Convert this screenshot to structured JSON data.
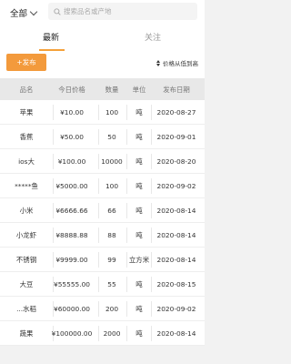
{
  "header": {
    "region_label": "全部",
    "search_placeholder": "搜索品名或产地"
  },
  "tabs": [
    {
      "label": "最新",
      "active": true
    },
    {
      "label": "关注",
      "active": false
    }
  ],
  "actions": {
    "publish_label": "+发布",
    "sort_label": "价格从低到高"
  },
  "colors": {
    "accent": "#f39a3c",
    "header_bg": "#e8e8e8"
  },
  "table": {
    "columns": [
      "品名",
      "今日价格",
      "数量",
      "单位",
      "发布日期"
    ],
    "rows": [
      {
        "name": "苹果",
        "price": "¥10.00",
        "qty": "100",
        "unit": "吨",
        "date": "2020-08-27"
      },
      {
        "name": "香蕉",
        "price": "¥50.00",
        "qty": "50",
        "unit": "吨",
        "date": "2020-09-01"
      },
      {
        "name": "ios大",
        "price": "¥100.00",
        "qty": "10000",
        "unit": "吨",
        "date": "2020-08-20"
      },
      {
        "name": "*****鱼",
        "price": "¥5000.00",
        "qty": "100",
        "unit": "吨",
        "date": "2020-09-02"
      },
      {
        "name": "小米",
        "price": "¥6666.66",
        "qty": "66",
        "unit": "吨",
        "date": "2020-08-14"
      },
      {
        "name": "小龙虾",
        "price": "¥8888.88",
        "qty": "88",
        "unit": "吨",
        "date": "2020-08-14"
      },
      {
        "name": "不锈钢",
        "price": "¥9999.00",
        "qty": "99",
        "unit": "立方米",
        "date": "2020-08-14"
      },
      {
        "name": "大豆",
        "price": "¥55555.00",
        "qty": "55",
        "unit": "吨",
        "date": "2020-08-15"
      },
      {
        "name": "...水稻",
        "price": "¥60000.00",
        "qty": "200",
        "unit": "吨",
        "date": "2020-09-02"
      },
      {
        "name": "蔬果",
        "price": "¥100000.00",
        "qty": "2000",
        "unit": "吨",
        "date": "2020-08-14"
      }
    ]
  }
}
